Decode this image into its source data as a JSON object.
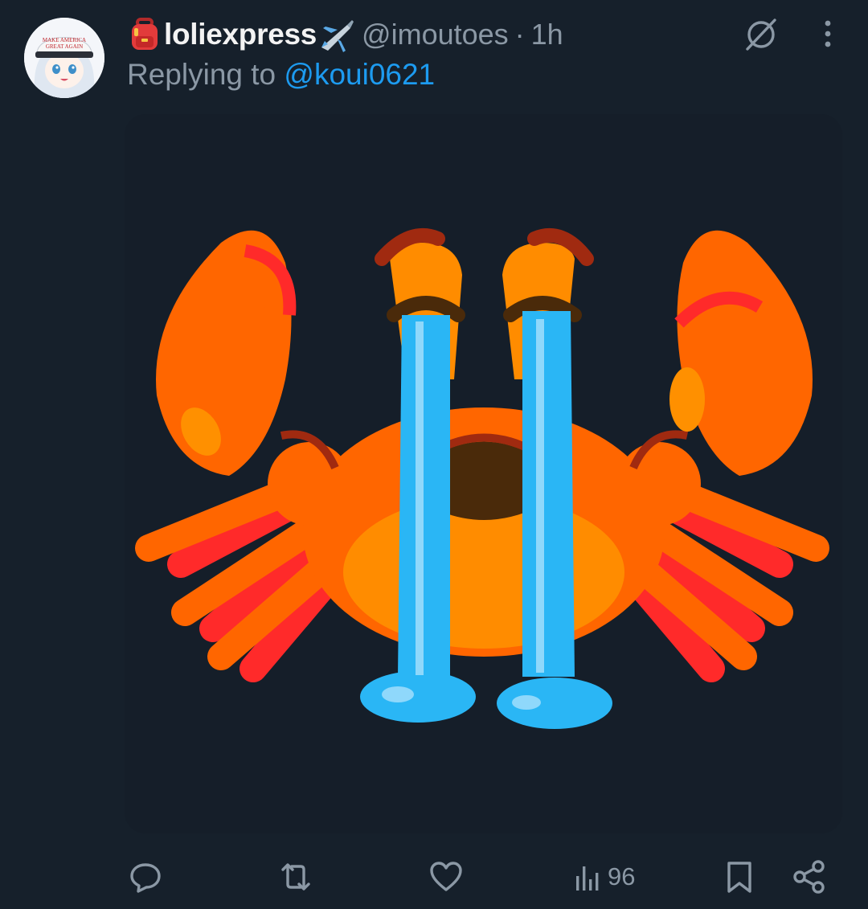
{
  "tweet": {
    "name_emoji_left": "backpack-emoji",
    "display_name": "loliexpress",
    "name_emoji_right": "airplane-emoji",
    "handle": "@imoutoes",
    "separator": "·",
    "time": "1h",
    "reply_prefix": "Replying to",
    "reply_mention": "@koui0621",
    "avatar_cap_text": [
      "MAKE AMERICA",
      "GREAT AGAIN"
    ],
    "media_alt": "crying crab emoji"
  },
  "top_actions": {
    "grok_icon": "grok-icon",
    "more_icon": "more-vertical-icon"
  },
  "actions": {
    "reply_icon": "reply-icon",
    "retweet_icon": "retweet-icon",
    "like_icon": "heart-icon",
    "views_icon": "views-bars-icon",
    "views_count": "96",
    "bookmark_icon": "bookmark-icon",
    "share_icon": "share-icon"
  },
  "colors": {
    "background": "#16202b",
    "muted_text": "#8b98a5",
    "link": "#1d9bf0",
    "crab_orange": "#ff6600",
    "tear_blue": "#2ab6f5"
  }
}
